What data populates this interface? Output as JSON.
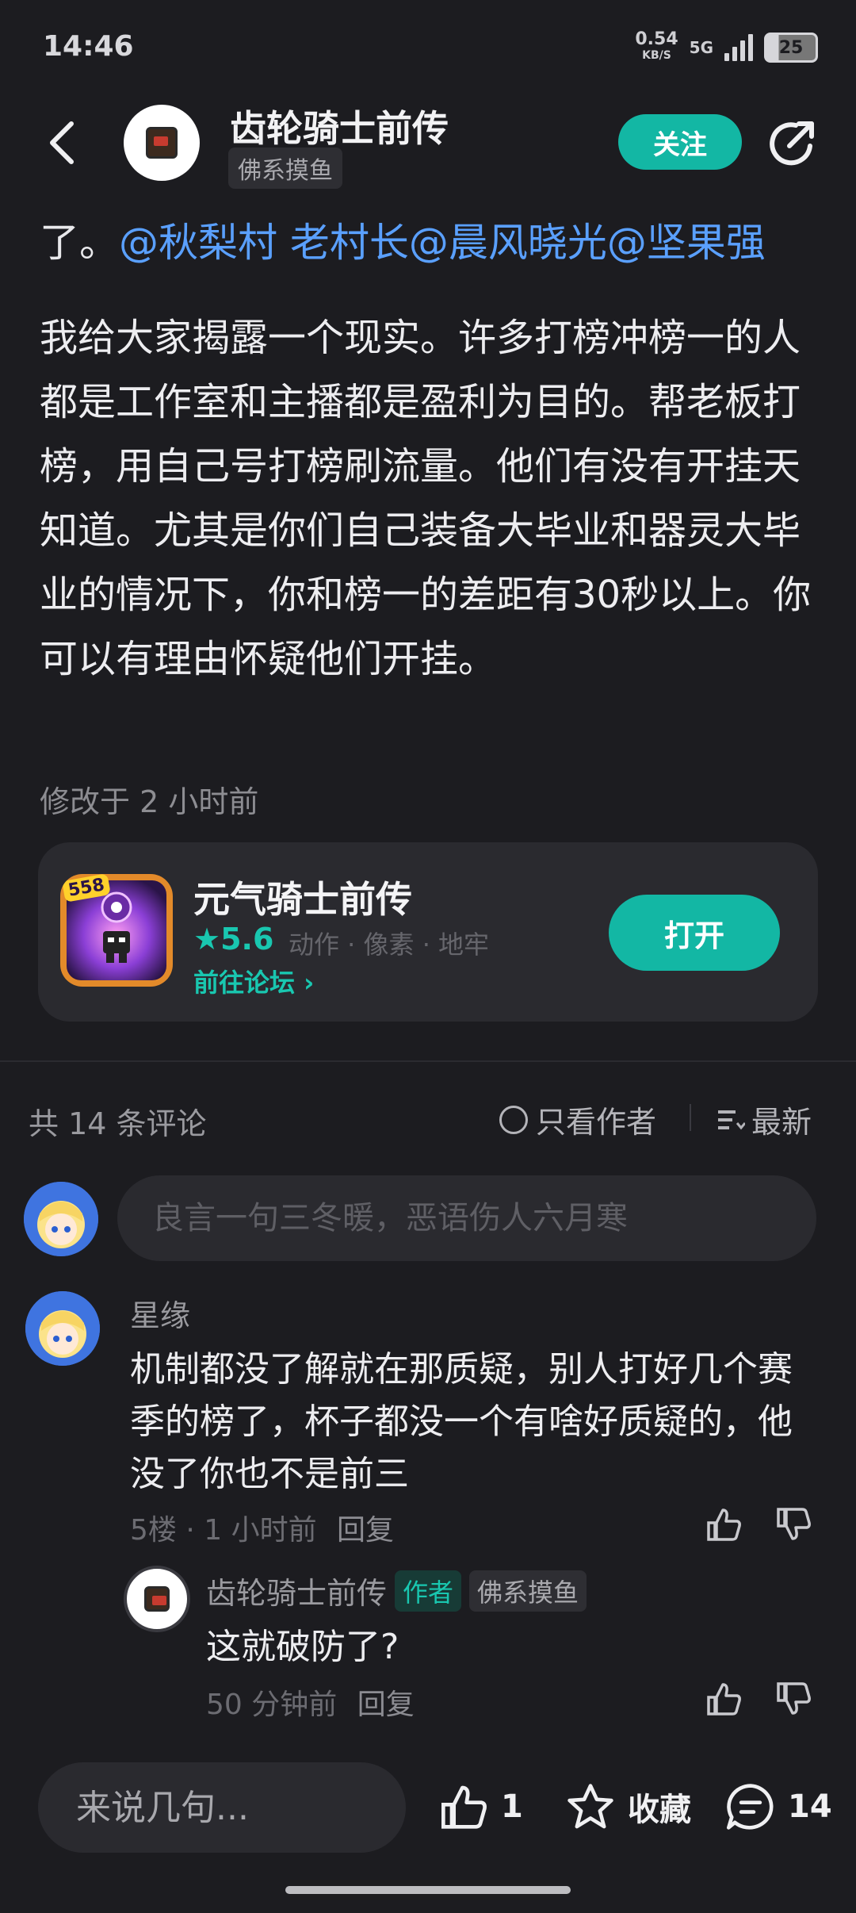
{
  "status_bar": {
    "time": "14:46",
    "net_speed": "0.54",
    "net_unit": "KB/S",
    "signal_label": "5G",
    "battery": "25"
  },
  "header": {
    "name": "齿轮骑士前传",
    "tag": "佛系摸鱼",
    "follow_label": "关注",
    "back_icon": "chevron-left-icon",
    "share_icon": "share-icon"
  },
  "post": {
    "lead": "了。",
    "mentions": [
      "@秋梨村 老村长",
      "@晨风晓光",
      "@坚果强"
    ],
    "body": "我给大家揭露一个现实。许多打榜冲榜一的人都是工作室和主播都是盈利为目的。帮老板打榜，用自己号打榜刷流量。他们有没有开挂天知道。尤其是你们自己装备大毕业和器灵大毕业的情况下，你和榜一的差距有30秒以上。你可以有理由怀疑他们开挂。",
    "modified": "修改于 2 小时前"
  },
  "app_card": {
    "name": "元气骑士前传",
    "rating": "5.6",
    "tags": "动作 · 像素 · 地牢",
    "forum_link": "前往论坛",
    "open_label": "打开",
    "icon_badge": "558"
  },
  "comments_section": {
    "count_label": "共 14 条评论",
    "author_only_label": "只看作者",
    "sort_label": "最新",
    "input_placeholder": "良言一句三冬暖，恶语伤人六月寒"
  },
  "comments": [
    {
      "author": "星缘",
      "text": "机制都没了解就在那质疑，别人打好几个赛季的榜了，杯子都没一个有啥好质疑的，他没了你也不是前三",
      "meta": "5楼 · 1 小时前",
      "reply_label": "回复"
    }
  ],
  "reply": {
    "author": "齿轮骑士前传",
    "author_badge": "作者",
    "tag": "佛系摸鱼",
    "text": "这就破防了?",
    "meta": "50 分钟前",
    "reply_label": "回复"
  },
  "bottom_bar": {
    "input_placeholder": "来说几句...",
    "like_count": "1",
    "collect_label": "收藏",
    "comment_count": "14"
  },
  "colors": {
    "accent": "#13b7a4",
    "mention": "#5aa0ff",
    "background": "#1c1c20"
  }
}
